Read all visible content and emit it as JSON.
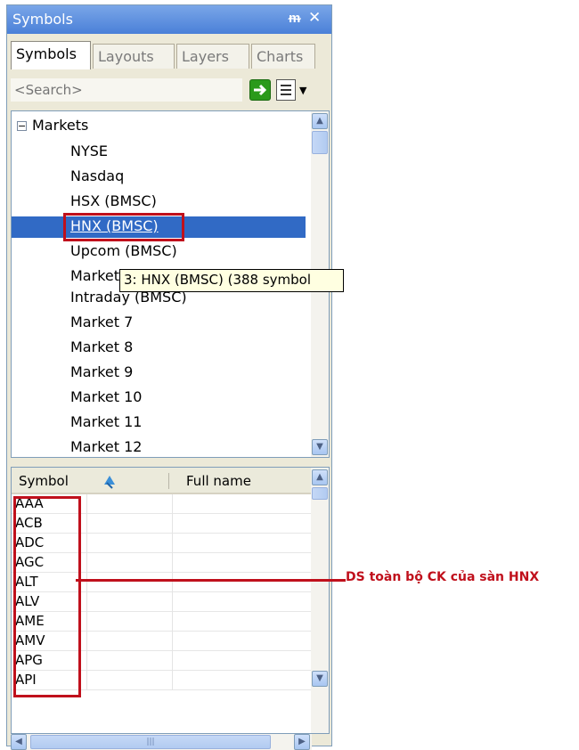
{
  "panel": {
    "title": "Symbols",
    "pin_glyph": "↕",
    "close_glyph": "✕"
  },
  "tabs": [
    {
      "label": "Symbols"
    },
    {
      "label": "Layouts"
    },
    {
      "label": "Layers"
    },
    {
      "label": "Charts"
    }
  ],
  "search": {
    "placeholder": "<Search>",
    "go_icon": "green-arrow-right-icon",
    "options_icon": "list-options-icon"
  },
  "tree": {
    "root_label": "Markets",
    "items": [
      {
        "label": "NYSE"
      },
      {
        "label": "Nasdaq"
      },
      {
        "label": "HSX (BMSC)"
      },
      {
        "label": "HNX (BMSC)"
      },
      {
        "label": "Upcom (BMSC)"
      },
      {
        "label": "Market"
      },
      {
        "label": "Intraday (BMSC)"
      },
      {
        "label": "Market 7"
      },
      {
        "label": "Market 8"
      },
      {
        "label": "Market 9"
      },
      {
        "label": "Market 10"
      },
      {
        "label": "Market 11"
      },
      {
        "label": "Market 12"
      }
    ],
    "selected_index": 3,
    "tooltip": "3: HNX (BMSC) (388 symbol"
  },
  "grid": {
    "columns": [
      "Symbol",
      "Full name"
    ],
    "sort_icon": "sort-arrows-icon",
    "rows": [
      "AAA",
      "ACB",
      "ADC",
      "AGC",
      "ALT",
      "ALV",
      "AME",
      "AMV",
      "APG",
      "API"
    ]
  },
  "annotation": {
    "text": "DS toàn bộ CK của sàn HNX",
    "color": "#c0101c"
  },
  "colors": {
    "title_bar": "#4a80d8",
    "selection": "#316ac5",
    "tooltip_bg": "#ffffe1"
  }
}
